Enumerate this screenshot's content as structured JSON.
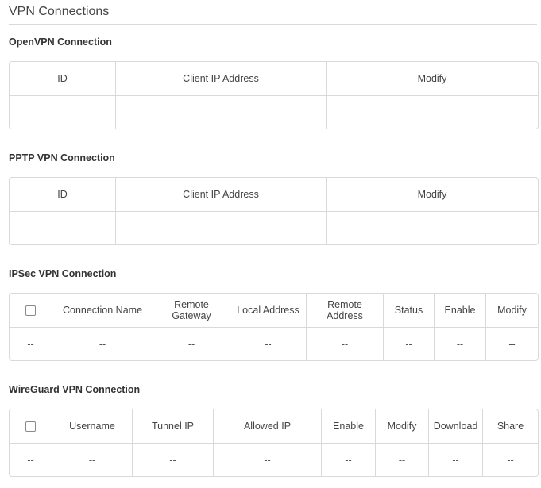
{
  "page": {
    "title": "VPN Connections"
  },
  "openvpn": {
    "title": "OpenVPN Connection",
    "headers": [
      "ID",
      "Client IP Address",
      "Modify"
    ],
    "row": [
      "--",
      "--",
      "--"
    ]
  },
  "pptp": {
    "title": "PPTP VPN Connection",
    "headers": [
      "ID",
      "Client IP Address",
      "Modify"
    ],
    "row": [
      "--",
      "--",
      "--"
    ]
  },
  "ipsec": {
    "title": "IPSec VPN Connection",
    "headers": [
      "Connection Name",
      "Remote Gateway",
      "Local Address",
      "Remote Address",
      "Status",
      "Enable",
      "Modify"
    ],
    "row": [
      "--",
      "--",
      "--",
      "--",
      "--",
      "--",
      "--",
      "--"
    ]
  },
  "wireguard": {
    "title": "WireGuard VPN Connection",
    "headers": [
      "Username",
      "Tunnel IP",
      "Allowed IP",
      "Enable",
      "Modify",
      "Download",
      "Share"
    ],
    "row": [
      "--",
      "--",
      "--",
      "--",
      "--",
      "--",
      "--",
      "--"
    ]
  }
}
